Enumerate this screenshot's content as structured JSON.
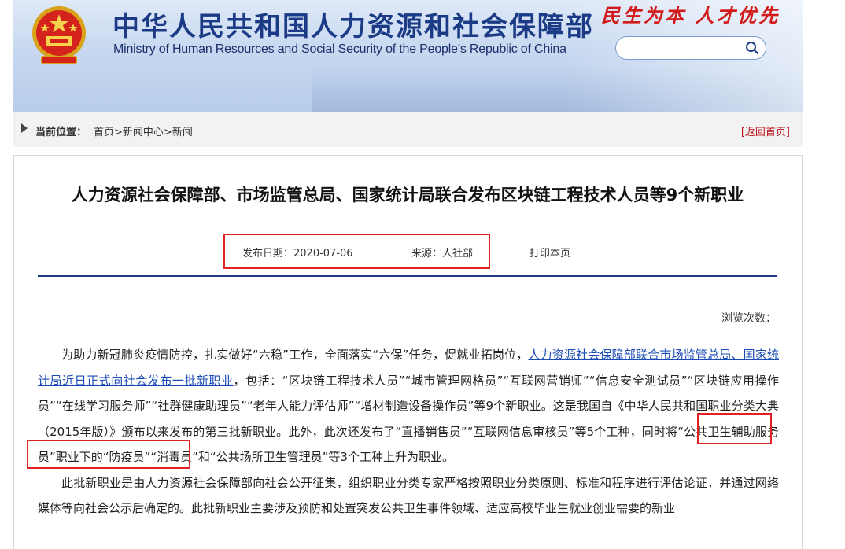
{
  "header": {
    "title_cn": "中华人民共和国人力资源和社会保障部",
    "title_en": "Ministry of Human Resources and Social Security of the People’s Republic of China",
    "slogan": "民生为本 人才优先",
    "emblem_icon": "national-emblem-icon",
    "search": {
      "placeholder": "",
      "icon": "search-icon"
    },
    "brand_color": "#1b3b87",
    "slogan_color": "#d21a1a"
  },
  "breadcrumb": {
    "label": "当前位置：",
    "items": [
      "首页",
      "新闻中心",
      "新闻"
    ],
    "separator": ">",
    "back_link": "[返回首页]"
  },
  "article": {
    "title": "人力资源社会保障部、市场监管总局、国家统计局联合发布区块链工程技术人员等9个新职业",
    "date": "发布日期：2020-07-06",
    "source": "来源：人社部",
    "print": "打印本页",
    "views": "浏览次数：",
    "p1_pre": "为助力新冠肺炎疫情防控，扎实做好“六稳”工作，全面落实“六保”任务，促就业拓岗位，",
    "p1_link": "人力资源社会保障部联合市场监管总局、国家统计局近日正式向社会发布一批新职业",
    "p1_post": "，包括：“区块链工程技术人员”“城市管理网格员”“互联网营销师”“信息安全测试员”“区块链应用操作员”“在线学习服务师”“社群健康助理员”“老年人能力评估师”“增材制造设备操作员”等9个新职业。这是我国自《中华人民共和国职业分类大典（2015年版）》颁布以来发布的第三批新职业。此外，此次还发布了“直播销售员”“互联网信息审核员”等5个工种，同时将“公共卫生辅助服务员”职业下的“防疫员”“消毒员”和“公共场所卫生管理员”等3个工种上升为职业。",
    "p2": "此批新职业是由人力资源社会保障部向社会公开征集，组织职业分类专家严格按照职业分类原则、标准和程序进行评估论证，并通过网络媒体等向社会公示后确定的。此批新职业主要涉及预防和处置突发公共卫生事件领域、适应高校毕业生就业创业需要的新业",
    "link_color": "#1a4bb5",
    "highlight_color": "#e12222"
  }
}
